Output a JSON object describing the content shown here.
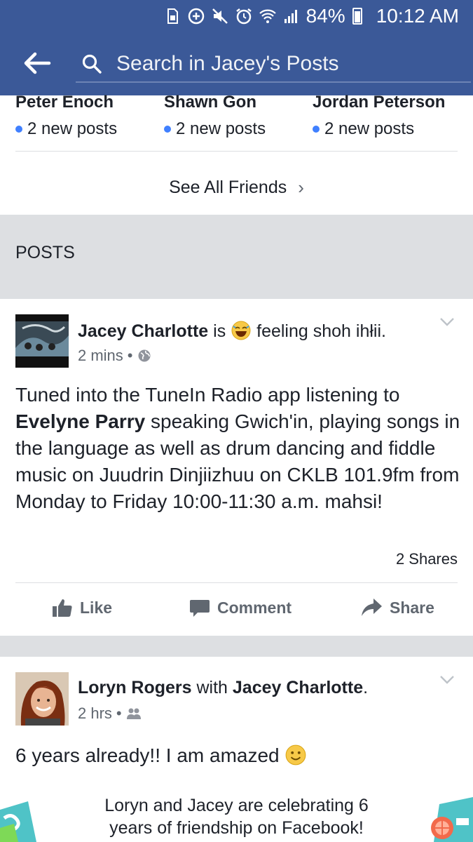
{
  "status_bar": {
    "battery": "84%",
    "time": "10:12 AM"
  },
  "header": {
    "search_placeholder": "Search in Jacey's Posts"
  },
  "friends": [
    {
      "name": "Peter Enoch",
      "posts": "2 new posts"
    },
    {
      "name": "Shawn Gon",
      "posts": "2 new posts"
    },
    {
      "name": "Jordan Peterson",
      "posts": "2 new posts"
    }
  ],
  "see_all": "See All Friends",
  "section_title": "POSTS",
  "post1": {
    "author": "Jacey Charlotte",
    "verb": "is",
    "feeling": "feeling shoh ihłii.",
    "time": "2 mins",
    "text_name": "Evelyne Parry",
    "text_before": "Tuned into the TuneIn Radio app listening to",
    "text_after": "speaking Gwich'in, playing songs in the language as well as drum dancing and fiddle music on Juudrin Dinjiizhuu on CKLB 101.9fm from Monday to Friday 10:00-11:30 a.m. mahsi!",
    "shares": "2 Shares",
    "actions": {
      "like": "Like",
      "comment": "Comment",
      "share": "Share"
    }
  },
  "post2": {
    "author": "Loryn Rogers",
    "with": "with",
    "tagged": "Jacey Charlotte",
    "time": "2 hrs",
    "text": "6 years already!! I am amazed",
    "anniversary": "Loryn and Jacey are celebrating 6 years of friendship on Facebook!"
  },
  "colors": {
    "brand": "#3b5998",
    "dot": "#4080ff",
    "gray_band": "#dddfe2"
  }
}
